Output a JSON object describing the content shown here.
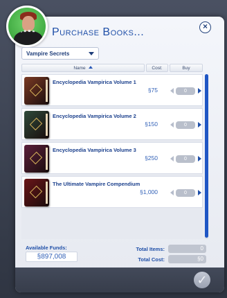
{
  "dialog": {
    "title": "Purchase Books...",
    "close_icon": "×",
    "confirm_icon": "✓"
  },
  "filter": {
    "selected": "Vampire Secrets"
  },
  "columns": {
    "name": "Name",
    "cost": "Cost:",
    "buy": "Buy"
  },
  "books": [
    {
      "name": "Encyclopedia Vampirica Volume 1",
      "cost": "§75",
      "qty": "0",
      "cover_color": "#7a3a24"
    },
    {
      "name": "Encyclopedia Vampirica Volume 2",
      "cost": "§150",
      "qty": "0",
      "cover_color": "#2e4a3a"
    },
    {
      "name": "Encyclopedia Vampirica Volume 3",
      "cost": "§250",
      "qty": "0",
      "cover_color": "#5a1f3a"
    },
    {
      "name": "The Ultimate Vampire Compendium",
      "cost": "§1,000",
      "qty": "0",
      "cover_color": "#6a1518"
    }
  ],
  "footer": {
    "funds_label": "Available Funds:",
    "funds_value": "§897,008",
    "total_items_label": "Total Items:",
    "total_items_value": "0",
    "total_cost_label": "Total Cost:",
    "total_cost_value": "§0"
  },
  "colors": {
    "accent": "#1f4fa8",
    "scroll_thumb": "#1f56c4"
  }
}
